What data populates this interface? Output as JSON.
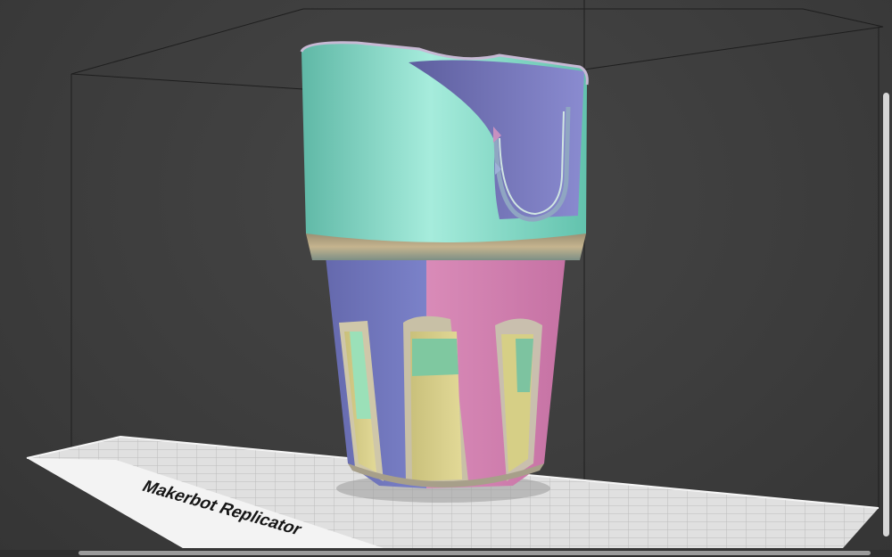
{
  "viewport": {
    "background_color": "#3d3d3d",
    "build_volume_line_color": "#1f1f1f"
  },
  "build_plate": {
    "label": "Makerbot Replicator",
    "plate_color": "#d9d9d9",
    "label_band_color": "#f3f3f3"
  },
  "model": {
    "type": "cup holder",
    "colors": {
      "upper_teal": "#7fd8c3",
      "inner_violet": "#6e6fb8",
      "lower_blue": "#6f77be",
      "lower_pink": "#d47fb0",
      "yellow": "#d6cf86",
      "green": "#7fc8a0"
    }
  },
  "scrollbars": {
    "right_track_color": "#d6d6d6",
    "bottom_thumb_color": "#9b9b9b"
  }
}
